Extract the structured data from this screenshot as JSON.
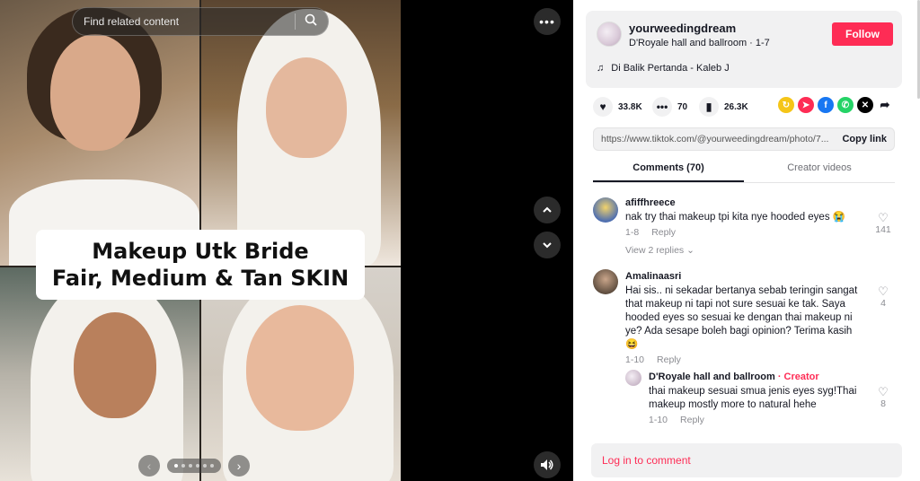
{
  "search": {
    "placeholder": "Find related content"
  },
  "post": {
    "caption_line1": "Makeup Utk Bride",
    "caption_line2": "Fair, Medium & Tan SKIN",
    "pager": {
      "total": 6,
      "current": 1
    }
  },
  "author": {
    "username": "yourweedingdream",
    "nickname_date": "D'Royale hall and ballroom · 1-7",
    "follow_label": "Follow",
    "music": "Di Balik Pertanda - Kaleb J"
  },
  "stats": {
    "likes": "33.8K",
    "comments": "70",
    "saves": "26.3K"
  },
  "link": {
    "url": "https://www.tiktok.com/@yourweedingdream/photo/7...",
    "copy_label": "Copy link"
  },
  "tabs": [
    {
      "label": "Comments (70)"
    },
    {
      "label": "Creator videos"
    }
  ],
  "comments": [
    {
      "name": "afiffhreece",
      "text": "nak try thai makeup tpi kita nye hooded eyes 😭",
      "date": "1-8",
      "reply": "Reply",
      "likes": "141",
      "view_replies": "View 2 replies ⌄"
    },
    {
      "name": "Amalinaasri",
      "text": "Hai sis.. ni sekadar bertanya sebab teringin sangat that makeup ni tapi not sure sesuai ke tak. Saya hooded eyes so sesuai ke dengan thai makeup ni ye? Ada sesape boleh bagi opinion? Terima kasih 😆",
      "date": "1-10",
      "reply": "Reply",
      "likes": "4"
    },
    {
      "name": "D'Royale hall and ballroom",
      "creator": "· Creator",
      "text": "thai makeup sesuai smua jenis eyes syg!Thai makeup mostly more to natural hehe",
      "date": "1-10",
      "reply": "Reply",
      "likes": "8"
    }
  ],
  "login_label": "Log in to comment",
  "colors": {
    "accent": "#fe2c55",
    "text": "#161823"
  }
}
